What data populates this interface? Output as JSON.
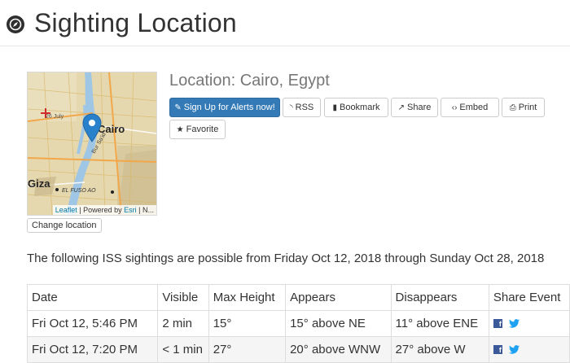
{
  "page": {
    "title": "Sighting Location"
  },
  "location": {
    "label": "Location:",
    "value": "Cairo, Egypt"
  },
  "map": {
    "labels": {
      "city": "Cairo",
      "giza": "Giza",
      "area": "EL FUSO AO",
      "road": "Bur Sa'id",
      "street": "26 July"
    },
    "attribution": {
      "leaflet": "Leaflet",
      "separator": " | Powered by ",
      "esri": "Esri",
      "tail": " | N..."
    }
  },
  "change_location_label": "Change location",
  "actions": {
    "alerts": "Sign Up for Alerts now!",
    "rss": "RSS",
    "bookmark": "Bookmark",
    "share": "Share",
    "embed": "Embed",
    "print": "Print",
    "favorite": "Favorite"
  },
  "intro_text": "The following ISS sightings are possible from Friday Oct 12, 2018 through Sunday Oct 28, 2018",
  "table": {
    "headers": [
      "Date",
      "Visible",
      "Max Height",
      "Appears",
      "Disappears",
      "Share Event"
    ],
    "rows": [
      [
        "Fri Oct 12, 5:46 PM",
        "2 min",
        "15°",
        "15° above NE",
        "11° above ENE"
      ],
      [
        "Fri Oct 12, 7:20 PM",
        "< 1 min",
        "27°",
        "20° above WNW",
        "27° above W"
      ]
    ]
  },
  "colors": {
    "primary": "#337ab7",
    "facebook": "#3b5998",
    "twitter": "#1da1f2",
    "marker": "#2a81cb"
  }
}
